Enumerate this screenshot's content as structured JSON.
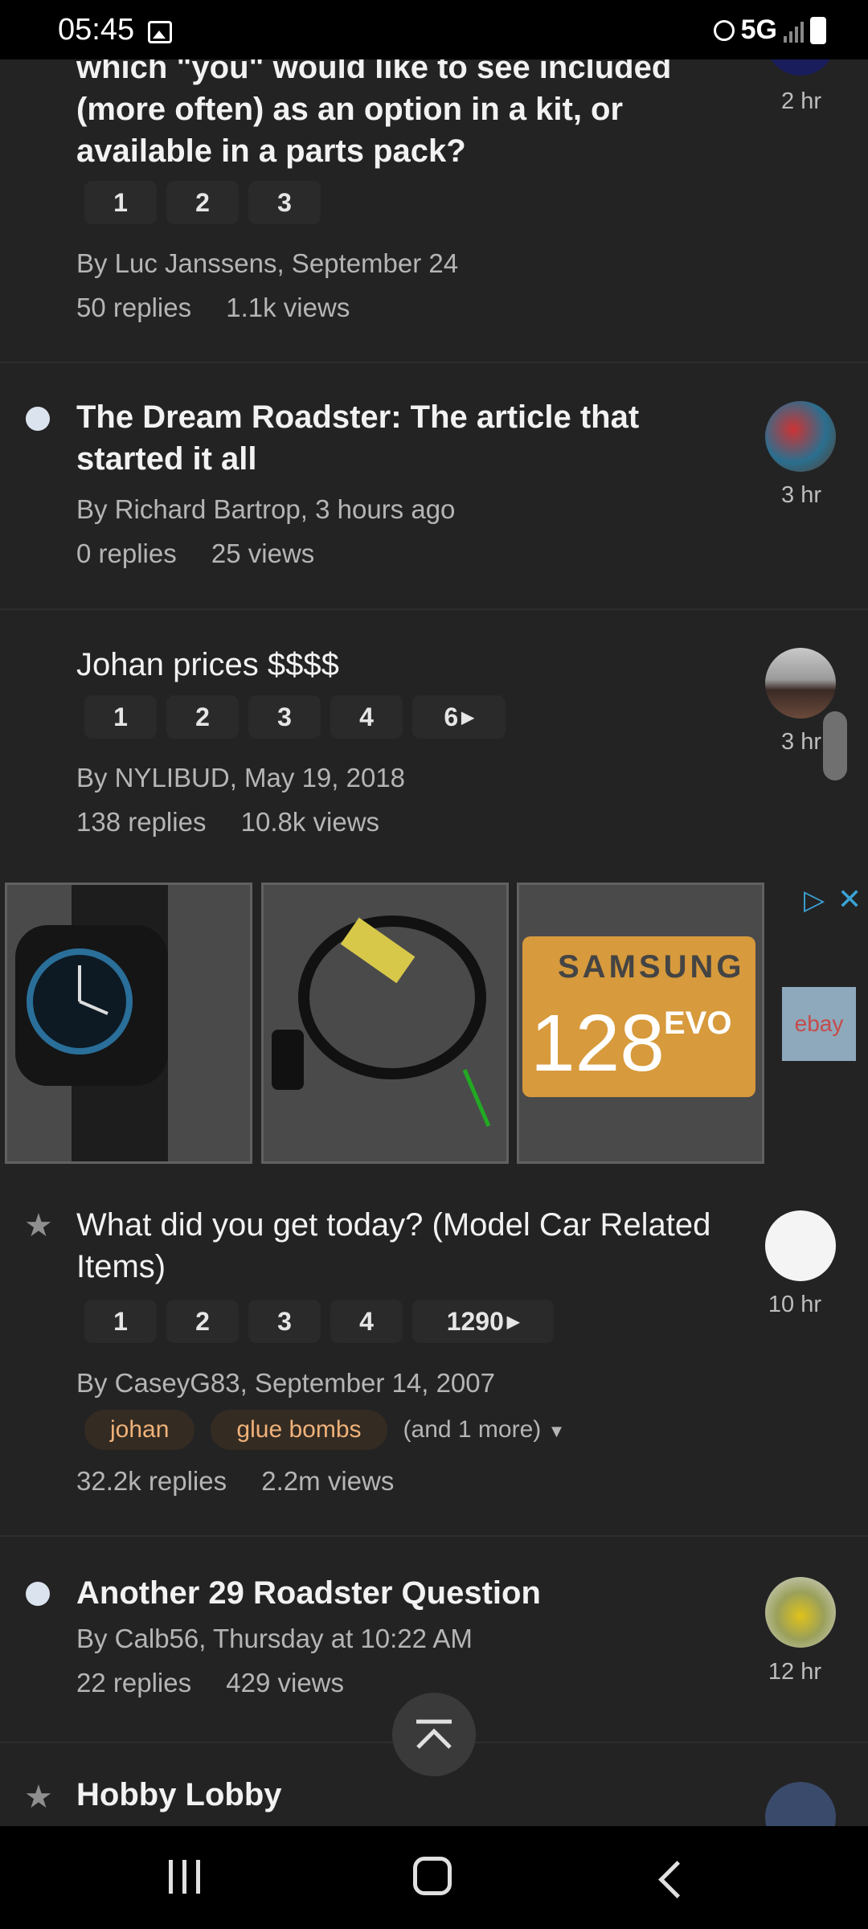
{
  "status_bar": {
    "time": "05:45",
    "network": "5G"
  },
  "topics": [
    {
      "title": "which \"you\" would like to see included (more often) as an option in a kit, or available in a parts pack?",
      "pages": [
        "1",
        "2",
        "3"
      ],
      "byline": "By Luc Janssens, September 24",
      "replies": "50 replies",
      "views": "1.1k views",
      "age": "2 hr"
    },
    {
      "title": "The Dream Roadster: The article that started it all",
      "byline": "By Richard Bartrop, 3 hours ago",
      "replies": "0 replies",
      "views": "25 views",
      "age": "3 hr"
    },
    {
      "title": "Johan prices $$$$",
      "pages": [
        "1",
        "2",
        "3",
        "4",
        "6"
      ],
      "byline": "By NYLIBUD, May 19, 2018",
      "replies": "138 replies",
      "views": "10.8k views",
      "age": "3 hr"
    },
    {
      "title": "What did you get today? (Model Car Related Items)",
      "pages": [
        "1",
        "2",
        "3",
        "4",
        "1290"
      ],
      "byline": "By CaseyG83, September 14, 2007",
      "tags": [
        "johan",
        "glue bombs"
      ],
      "tags_more": "(and 1 more)",
      "replies": "32.2k replies",
      "views": "2.2m views",
      "age": "10 hr"
    },
    {
      "title": "Another 29 Roadster Question",
      "byline": "By Calb56, Thursday at 10:22 AM",
      "replies": "22 replies",
      "views": "429 views",
      "age": "12 hr"
    },
    {
      "title": "Hobby Lobby"
    }
  ],
  "ad": {
    "samsung_brand": "SAMSUNG",
    "samsung_capacity": "128",
    "samsung_model": "EVO",
    "ebay": "ebay"
  },
  "colors": {
    "background": "#232324",
    "tag_bg": "#342b22",
    "tag_text": "#f0b27a"
  }
}
